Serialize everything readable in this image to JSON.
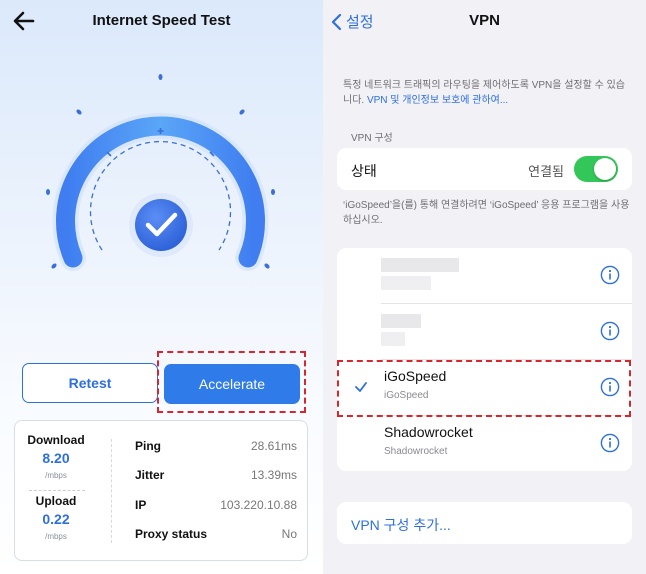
{
  "left": {
    "title": "Internet Speed Test",
    "retest_label": "Retest",
    "accelerate_label": "Accelerate",
    "download": {
      "label": "Download",
      "value": "8.20",
      "unit": "/mbps"
    },
    "upload": {
      "label": "Upload",
      "value": "0.22",
      "unit": "/mbps"
    },
    "metrics": [
      {
        "label": "Ping",
        "value": "28.61ms"
      },
      {
        "label": "Jitter",
        "value": "13.39ms"
      },
      {
        "label": "IP",
        "value": "103.220.10.88"
      },
      {
        "label": "Proxy status",
        "value": "No"
      }
    ],
    "colors": {
      "accent": "#2f7bea",
      "highlight": "#d9262c"
    },
    "icons": {
      "back": "back-arrow-icon",
      "status": "checkmark-icon"
    }
  },
  "right": {
    "back_label": "설정",
    "title": "VPN",
    "description": "특정 네트워크 트래픽의 라우팅을 제어하도록 VPN을 설정할 수 있습니다.",
    "description_link": "VPN 및 개인정보 보호에 관하여...",
    "section_label": "VPN 구성",
    "status_label": "상태",
    "status_value": "연결됨",
    "toggle_on": true,
    "note": "‘iGoSpeed’을(를) 통해 연결하려면 ‘iGoSpeed’ 응용 프로그램을 사용하십시오.",
    "vpn_configs": [
      {
        "name": "iGoSpeed",
        "subtitle": "iGoSpeed",
        "selected": true
      },
      {
        "name": "Shadowrocket",
        "subtitle": "Shadowrocket",
        "selected": false
      }
    ],
    "add_label": "VPN 구성 추가...",
    "colors": {
      "link": "#2d6fe0",
      "toggle": "#33c759"
    }
  }
}
